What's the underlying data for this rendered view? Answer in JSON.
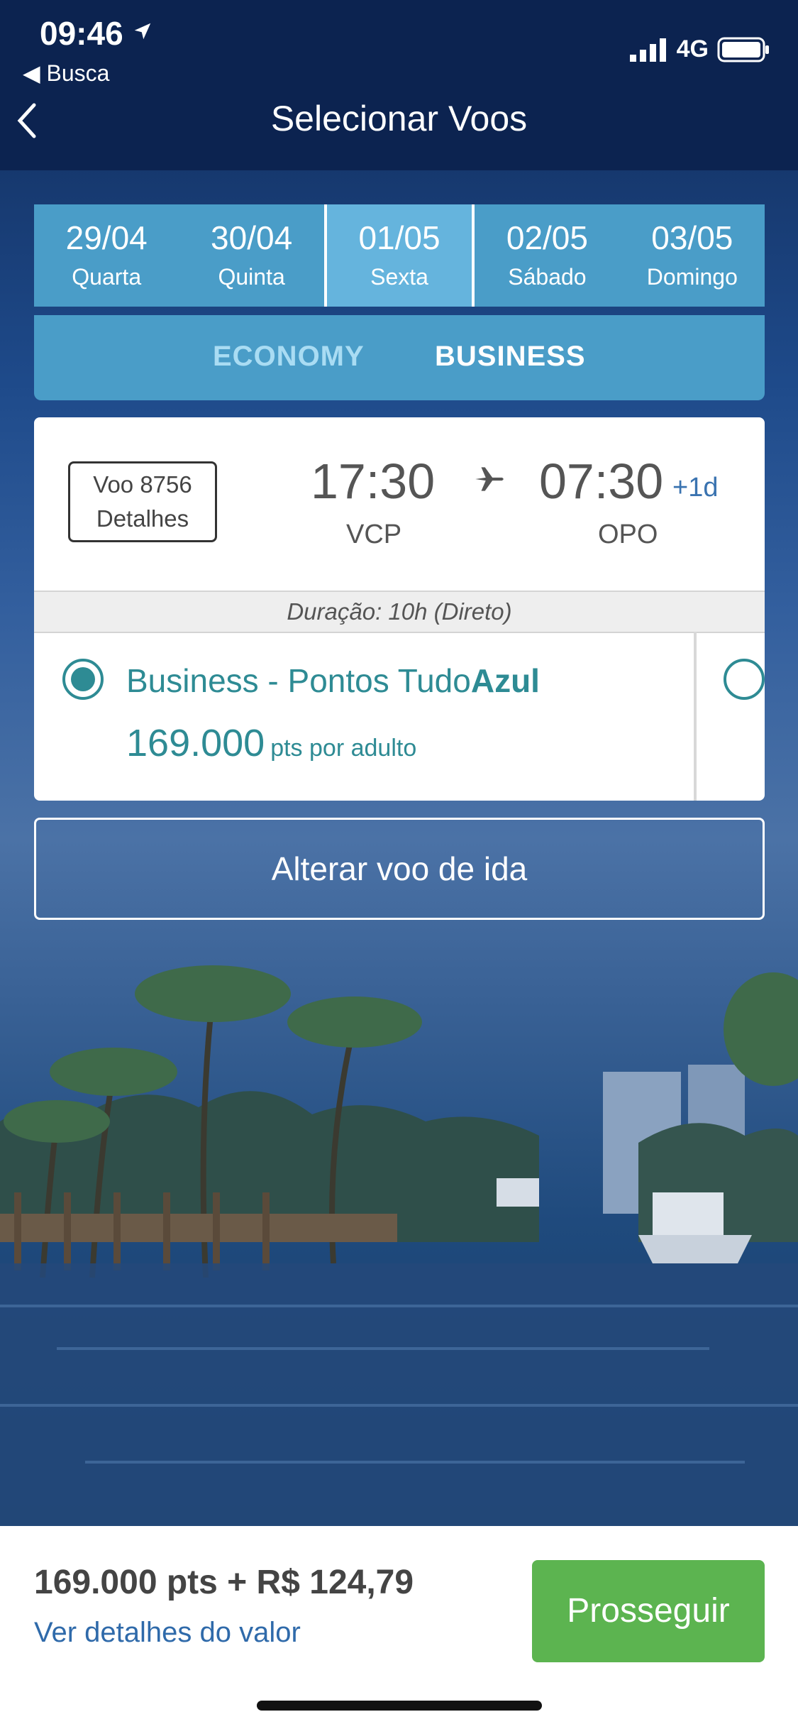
{
  "status_bar": {
    "time": "09:46",
    "back_app": "Busca",
    "network": "4G"
  },
  "nav": {
    "title": "Selecionar Voos"
  },
  "dates": [
    {
      "date": "29/04",
      "weekday": "Quarta"
    },
    {
      "date": "30/04",
      "weekday": "Quinta"
    },
    {
      "date": "01/05",
      "weekday": "Sexta"
    },
    {
      "date": "02/05",
      "weekday": "Sábado"
    },
    {
      "date": "03/05",
      "weekday": "Domingo"
    }
  ],
  "cabins": {
    "economy": "ECONOMY",
    "business": "BUSINESS"
  },
  "flight": {
    "flight_label": "Voo 8756",
    "details_label": "Detalhes",
    "departure_time": "17:30",
    "arrival_time": "07:30",
    "day_offset": "+1d",
    "origin": "VCP",
    "destination": "OPO",
    "duration": "Duração: 10h (Direto)"
  },
  "fare": {
    "name_prefix": "Business - Pontos Tudo",
    "name_bold": "Azul",
    "points": "169.000",
    "points_unit": "pts por adulto"
  },
  "alter_button": "Alterar voo de ida",
  "bottom": {
    "total": "169.000 pts + R$ 124,79",
    "details_link": "Ver detalhes do valor",
    "proceed": "Prosseguir"
  },
  "colors": {
    "header": "#0c2350",
    "tab_blue": "#4a9dc8",
    "teal": "#2e8b94",
    "green": "#5cb450",
    "link": "#2f6aaa"
  }
}
